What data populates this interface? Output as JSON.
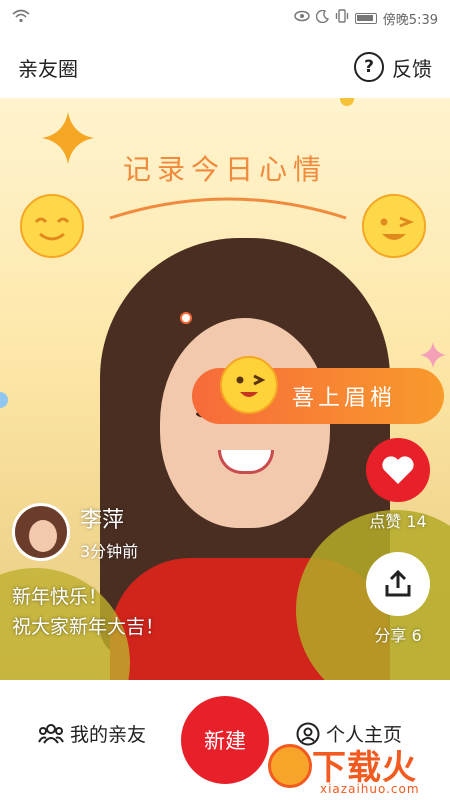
{
  "status_bar": {
    "right_text": "傍晚5:39"
  },
  "header": {
    "title": "亲友圈",
    "feedback_label": "反馈",
    "help_glyph": "?"
  },
  "banner": {
    "headline": "记录今日心情",
    "mood_pill": "喜上眉梢"
  },
  "post": {
    "author_name": "李萍",
    "time_ago": "3分钟前",
    "text_line1": "新年快乐！",
    "text_line2": "祝大家新年大吉！",
    "like_label": "点赞 14",
    "share_label": "分享 6"
  },
  "bottom_nav": {
    "friends_label": "我的亲友",
    "new_label": "新建",
    "profile_label": "个人主页"
  },
  "watermark": {
    "main": "下载火",
    "sub": "xiazaihuo.com"
  },
  "colors": {
    "accent_red": "#e8202a",
    "pill_orange": "#f76b3a",
    "headline_orange": "#f08a3c"
  },
  "icons": [
    "wifi-icon",
    "eye-icon",
    "moon-icon",
    "vibrate-icon",
    "battery-icon",
    "help-icon",
    "heart-icon",
    "share-icon",
    "friends-icon",
    "profile-icon"
  ]
}
